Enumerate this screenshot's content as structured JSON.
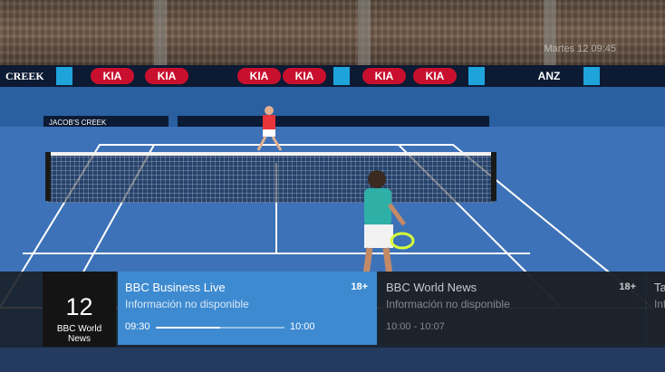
{
  "overlay": {
    "clock_text": "Martes 12  09:45"
  },
  "channel": {
    "number": "12",
    "name": "BBC World\nNews"
  },
  "programs": [
    {
      "title": "BBC Business Live",
      "rating": "18+",
      "info": "Información no disponible",
      "start": "09:30",
      "end": "10:00",
      "progress": 0.5
    },
    {
      "title": "BBC World News",
      "rating": "18+",
      "info": "Información no disponible",
      "time": "10:00 - 10:07"
    },
    {
      "title": "Tall",
      "info": "Info"
    }
  ],
  "banners": {
    "creek": "CREEK",
    "kia": "KIA",
    "anz": "ANZ",
    "jacobs": "JACOB'S CREEK"
  },
  "colors": {
    "active_program": "#3d8ad0",
    "court": "#3d72b8",
    "banner": "#0c1a33",
    "kia_red": "#c8102e"
  }
}
